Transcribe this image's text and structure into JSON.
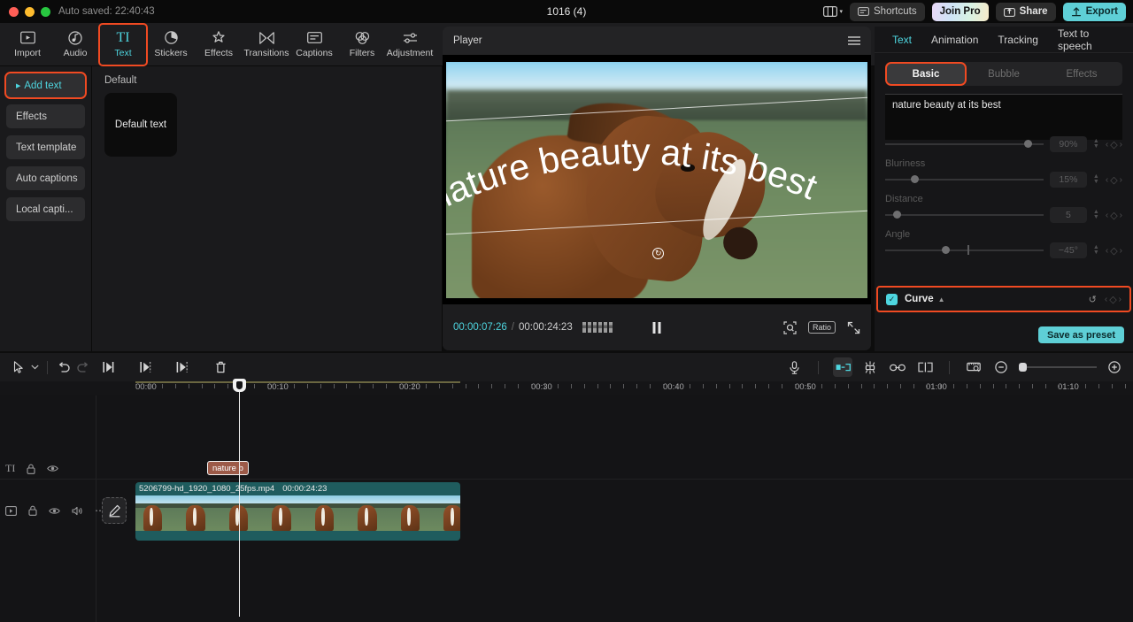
{
  "titlebar": {
    "autosave": "Auto saved: 22:40:43",
    "window_title": "1016 (4)",
    "layout_icon": "layout-icon",
    "chevron": "▾",
    "shortcuts_label": "Shortcuts",
    "shortcuts_icon": "keyboard-icon",
    "joinpro_label": "Join Pro",
    "share_label": "Share",
    "share_icon": "share-icon",
    "export_label": "Export",
    "export_icon": "upload-icon",
    "accent": "#5ecfd6"
  },
  "modules": [
    {
      "label": "Import",
      "icon": "import-icon"
    },
    {
      "label": "Audio",
      "icon": "audio-icon"
    },
    {
      "label": "Text",
      "icon": "text-icon"
    },
    {
      "label": "Stickers",
      "icon": "stickers-icon"
    },
    {
      "label": "Effects",
      "icon": "effects-icon"
    },
    {
      "label": "Transitions",
      "icon": "transitions-icon"
    },
    {
      "label": "Captions",
      "icon": "captions-icon"
    },
    {
      "label": "Filters",
      "icon": "filters-icon"
    },
    {
      "label": "Adjustment",
      "icon": "adjustment-icon"
    }
  ],
  "library": {
    "items": [
      {
        "label": "Add text",
        "selected": true
      },
      {
        "label": "Effects",
        "selected": false
      },
      {
        "label": "Text template",
        "selected": false
      },
      {
        "label": "Auto captions",
        "selected": false
      },
      {
        "label": "Local capti...",
        "selected": false
      }
    ]
  },
  "presets": {
    "group_title": "Default",
    "cards": [
      {
        "label": "Default text"
      }
    ]
  },
  "player": {
    "title": "Player",
    "menu_icon": "hamburger-icon",
    "overlay_text": "nature beauty at its best",
    "rotate_handle_icon": "rotate-icon",
    "current_time": "00:00:07:26",
    "separator": "/",
    "total_time": "00:00:24:23",
    "frames_icon": "frames-icon",
    "play_icon": "pause-icon",
    "zoom_icon": "zoom-fit-icon",
    "ratio_label": "Ratio",
    "fullscreen_icon": "fullscreen-icon"
  },
  "inspector": {
    "tabs": [
      {
        "label": "Text",
        "active": true
      },
      {
        "label": "Animation",
        "active": false
      },
      {
        "label": "Tracking",
        "active": false
      },
      {
        "label": "Text to speech",
        "active": false
      }
    ],
    "segments": [
      {
        "label": "Basic",
        "active": true
      },
      {
        "label": "Bubble",
        "active": false
      },
      {
        "label": "Effects",
        "active": false
      }
    ],
    "text_value": "nature beauty at its best",
    "properties": [
      {
        "label": "",
        "value": "90%",
        "fill": 0.9,
        "hidden_label": true
      },
      {
        "label": "Bluriness",
        "value": "15%",
        "fill": 0.18
      },
      {
        "label": "Distance",
        "value": "5",
        "fill": 0.07
      },
      {
        "label": "Angle",
        "value": "−45°",
        "fill": 0.38,
        "has_tick": true
      }
    ],
    "curve": {
      "label": "Curve",
      "checked": true,
      "collapse_icon": "chevron-up-icon",
      "reset_icon": "reset-icon",
      "keyframe_prev": "‹",
      "keyframe_diamond": "◇",
      "keyframe_next": "›"
    },
    "save_preset_label": "Save as preset"
  },
  "timeline": {
    "tools_left": [
      {
        "icon": "cursor-icon",
        "name": "select-tool"
      },
      {
        "icon": "chevron-down-icon",
        "name": "tool-dropdown"
      },
      {
        "icon": "undo-icon",
        "name": "undo-button"
      },
      {
        "icon": "redo-icon",
        "name": "redo-button"
      },
      {
        "icon": "split-icon",
        "name": "split-button"
      },
      {
        "icon": "trim-left-icon",
        "name": "trim-left-button"
      },
      {
        "icon": "trim-right-icon",
        "name": "trim-right-button"
      },
      {
        "icon": "delete-icon",
        "name": "delete-button"
      }
    ],
    "tools_right": [
      {
        "icon": "mic-icon",
        "name": "record-voiceover-button"
      },
      {
        "icon": "auto-fit-icon",
        "name": "auto-fit-button"
      },
      {
        "icon": "mixer-icon",
        "name": "mixer-button"
      },
      {
        "icon": "link-icon",
        "name": "link-button"
      },
      {
        "icon": "crop-marker-icon",
        "name": "marker-button"
      },
      {
        "icon": "manager-icon",
        "name": "clip-manager-button"
      },
      {
        "icon": "zoom-out-icon",
        "name": "zoom-out-button"
      },
      {
        "icon": "zoom-in-icon",
        "name": "zoom-in-button"
      }
    ],
    "ruler_labels": [
      "00:00",
      "00:10",
      "00:20",
      "00:30",
      "00:40",
      "00:50",
      "01:00",
      "01:10"
    ],
    "text_track": {
      "icon": "text-track-icon",
      "lock_icon": "lock-icon",
      "eye_icon": "eye-icon",
      "clip_label": "nature b"
    },
    "video_track": {
      "icon": "video-track-icon",
      "lock_icon": "lock-icon",
      "eye_icon": "eye-icon",
      "volume_icon": "volume-icon",
      "more_icon": "more-icon",
      "edit_icon": "edit-pencil-icon",
      "clip_name": "5206799-hd_1920_1080_25fps.mp4",
      "clip_duration": "00:00:24:23"
    }
  }
}
